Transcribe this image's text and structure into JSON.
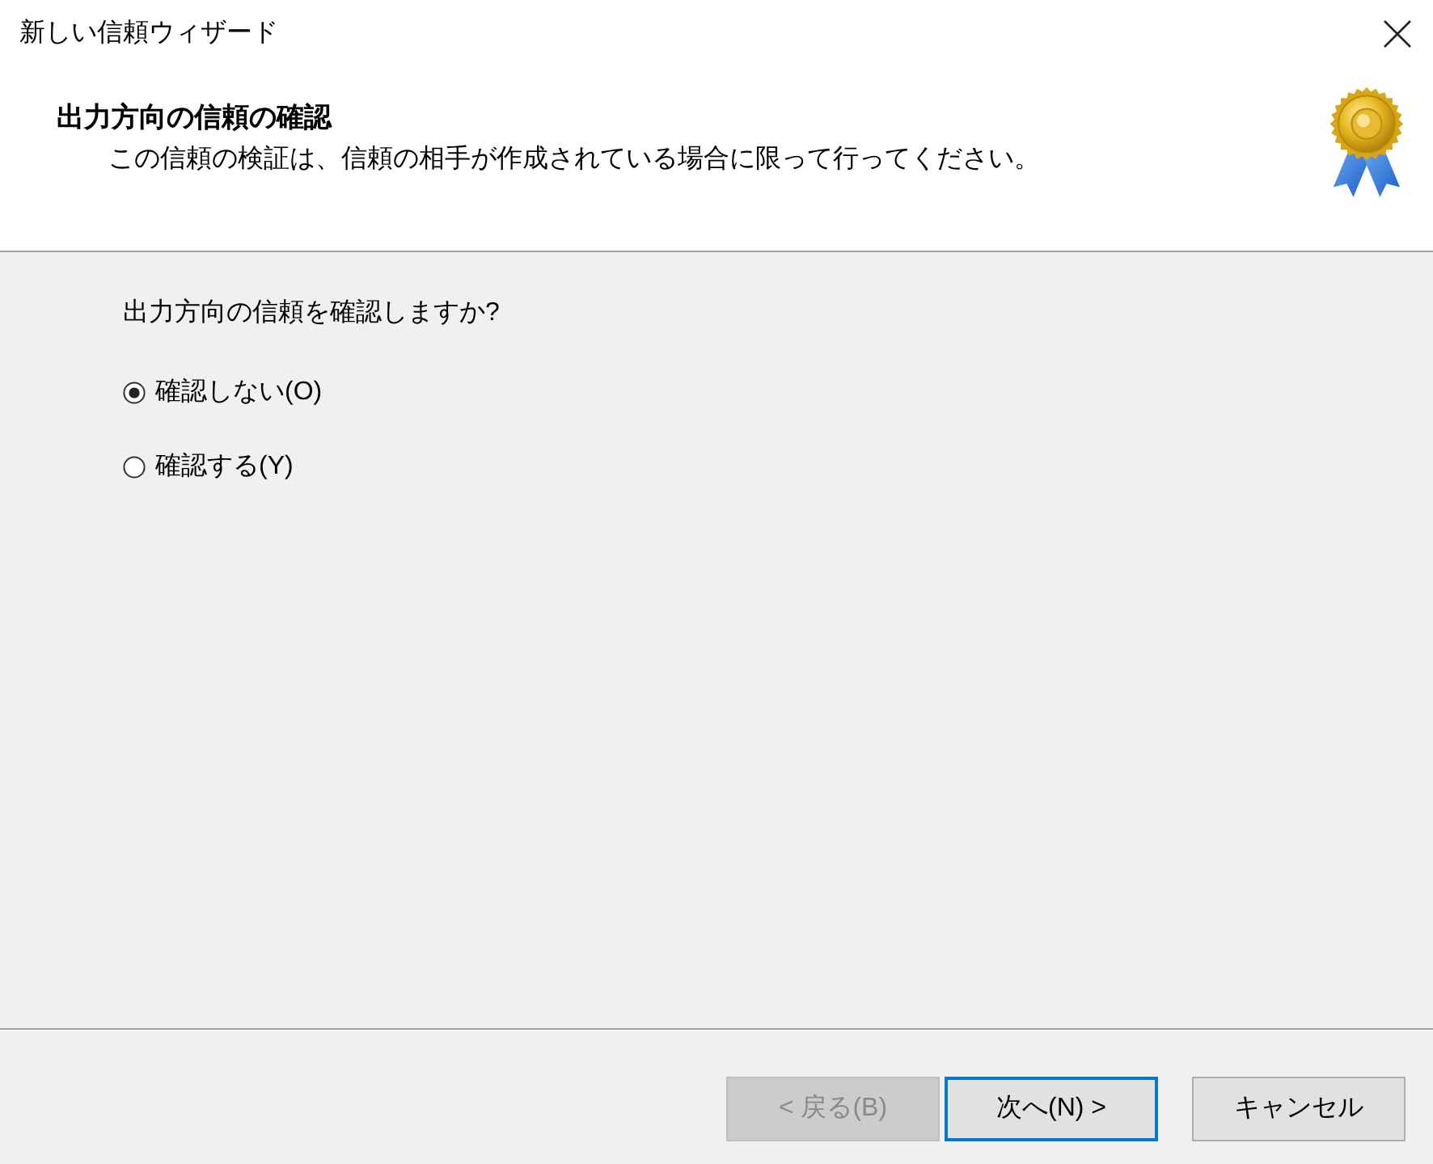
{
  "window": {
    "title": "新しい信頼ウィザード"
  },
  "header": {
    "title": "出力方向の信頼の確認",
    "subtitle": "この信頼の検証は、信頼の相手が作成されている場合に限って行ってください。"
  },
  "question": "出力方向の信頼を確認しますか?",
  "options": [
    {
      "label": "確認しない(O)",
      "selected": true
    },
    {
      "label": "確認する(Y)",
      "selected": false
    }
  ],
  "buttons": [
    {
      "label": "< 戻る(B)",
      "disabled": true,
      "focused": false
    },
    {
      "label": "次へ(N) >",
      "disabled": false,
      "focused": true
    },
    {
      "label": "キャンセル",
      "disabled": false,
      "focused": false
    }
  ]
}
